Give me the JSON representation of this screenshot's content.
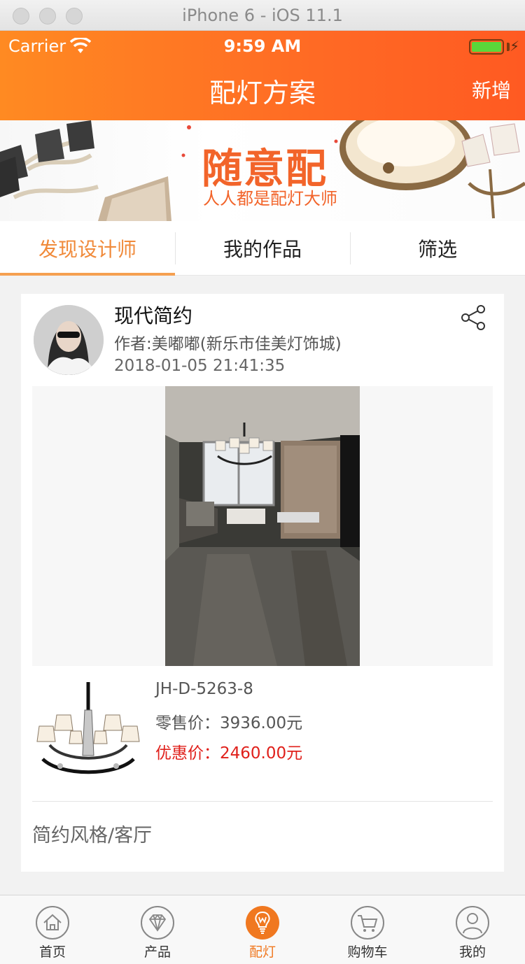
{
  "simulator": {
    "title": "iPhone 6 - iOS 11.1"
  },
  "status_bar": {
    "carrier": "Carrier",
    "time": "9:59 AM"
  },
  "nav": {
    "title": "配灯方案",
    "add_label": "新增"
  },
  "banner": {
    "headline": "随意配",
    "subline": "人人都是配灯大师"
  },
  "tabs": [
    {
      "label": "发现设计师",
      "active": true
    },
    {
      "label": "我的作品",
      "active": false
    },
    {
      "label": "筛选",
      "active": false
    }
  ],
  "card": {
    "title": "现代简约",
    "author": "作者:美嘟嘟(新乐市佳美灯饰城)",
    "date": "2018-01-05 21:41:35",
    "product": {
      "sku": "JH-D-5263-8",
      "retail_price": "零售价：3936.00元",
      "discount_price": "优惠价：2460.00元"
    },
    "tag": "简约风格/客厅"
  },
  "tabbar": [
    {
      "label": "首页",
      "icon": "home-icon",
      "active": false
    },
    {
      "label": "产品",
      "icon": "diamond-icon",
      "active": false
    },
    {
      "label": "配灯",
      "icon": "bulb-icon",
      "active": true
    },
    {
      "label": "购物车",
      "icon": "cart-icon",
      "active": false
    },
    {
      "label": "我的",
      "icon": "user-icon",
      "active": false
    }
  ],
  "colors": {
    "accent": "#f07820",
    "header_start": "#ff8a22",
    "header_end": "#ff5a22",
    "discount": "#e0201b"
  }
}
